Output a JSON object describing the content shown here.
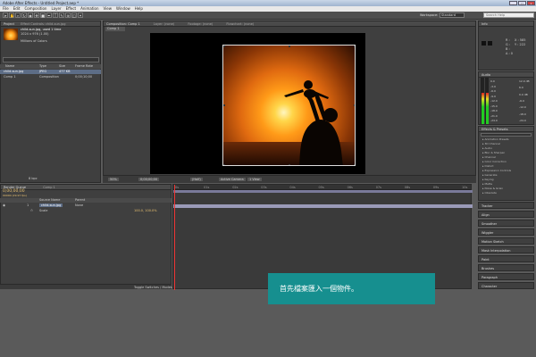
{
  "window": {
    "title": "Adobe After Effects - Untitled Project.aep *",
    "controls": [
      "_",
      "□",
      "x"
    ]
  },
  "menu": [
    "File",
    "Edit",
    "Composition",
    "Layer",
    "Effect",
    "Animation",
    "View",
    "Window",
    "Help"
  ],
  "toolbar": {
    "workspace_label": "Workspace:",
    "workspace_value": "Standard",
    "search_placeholder": "Search Help"
  },
  "project_panel": {
    "tab": "Project",
    "tab_inactive": "Effect Controls: child-sun.jpg",
    "item_name": "child-sun.jpg",
    "item_note": ", used 1 time",
    "item_dims": "1024 x 976 (1.00)",
    "item_color": "Millions of Colors",
    "columns": [
      "Name",
      "Type",
      "Size",
      "Frame Rate"
    ],
    "rows": [
      {
        "name": "child-sun.jpg",
        "type": "JPEG",
        "size": "477 KB",
        "rate": ""
      },
      {
        "name": "Comp 1",
        "type": "Composition",
        "size": "",
        "rate": "0;00;10;00"
      }
    ],
    "bpc": "8 bpc"
  },
  "comp_panel": {
    "tab": "Composition: Comp 1",
    "tab2": "Layer: (none)",
    "tab3": "Footage: (none)",
    "tab4": "Flowchart: (none)",
    "subtab": "Comp 1",
    "zoom": "50%",
    "timecode": "0;00;00;00",
    "resolution": "(Half)",
    "view": "Active Camera",
    "views": "1 View"
  },
  "info_panel": {
    "tab": "Info",
    "r_label": "R :",
    "g_label": "G :",
    "b_label": "B :",
    "a_label": "A : 0",
    "x_label": "X : 585",
    "y_label": "Y : 222"
  },
  "audio_panel": {
    "tab": "Audio",
    "levels_left": [
      "0.0",
      "-3.0",
      "-6.0",
      "-9.0",
      "-12.0",
      "-15.0",
      "-18.0",
      "-21.0",
      "-24.0"
    ],
    "levels_right": [
      "12.0 dB",
      "6.0",
      "0.0 dB",
      "-6.0",
      "-12.0",
      "-18.0",
      "-24.0"
    ],
    "meter_fill": 0.68
  },
  "effects_panel": {
    "tab": "Effects & Presets",
    "items": [
      "Animation Presets",
      "3D Channel",
      "Audio",
      "Blur & Sharpen",
      "Channel",
      "Color Correction",
      "Distort",
      "Expression Controls",
      "Generate",
      "Keying",
      "Matte",
      "Noise & Grain",
      "Obsolete"
    ]
  },
  "side_panels": [
    "Tracker",
    "Align",
    "Smoother",
    "Wiggler",
    "Motion Sketch",
    "Mask Interpolation",
    "Paint",
    "Brushes",
    "Paragraph",
    "Character"
  ],
  "timeline": {
    "tab_render": "Render Queue",
    "tab_comp": "Comp 1",
    "timecode": "0;00;00;00",
    "fps": "00000 (29.97 fps)",
    "col_source": "Source Name",
    "col_parent": "Parent",
    "layer_num": "1",
    "layer_name": "child-sun.jpg",
    "parent_value": "None",
    "scale_label": "Scale",
    "scale_value": "100.0, 100.0%",
    "toggle_label": "Toggle Switches / Modes",
    "ruler_labels": [
      "0s",
      "01s",
      "02s",
      "03s",
      "04s",
      "05s",
      "06s",
      "07s",
      "08s",
      "09s",
      "10s"
    ],
    "work_area_fraction": 1.0
  },
  "caption": "首先檔案匯入一個物件。",
  "colors": {
    "caption_bg": "#168f8f",
    "panel_bg": "#3f3f3f",
    "timecode": "#e8c070",
    "track": "#9a9ab8"
  }
}
